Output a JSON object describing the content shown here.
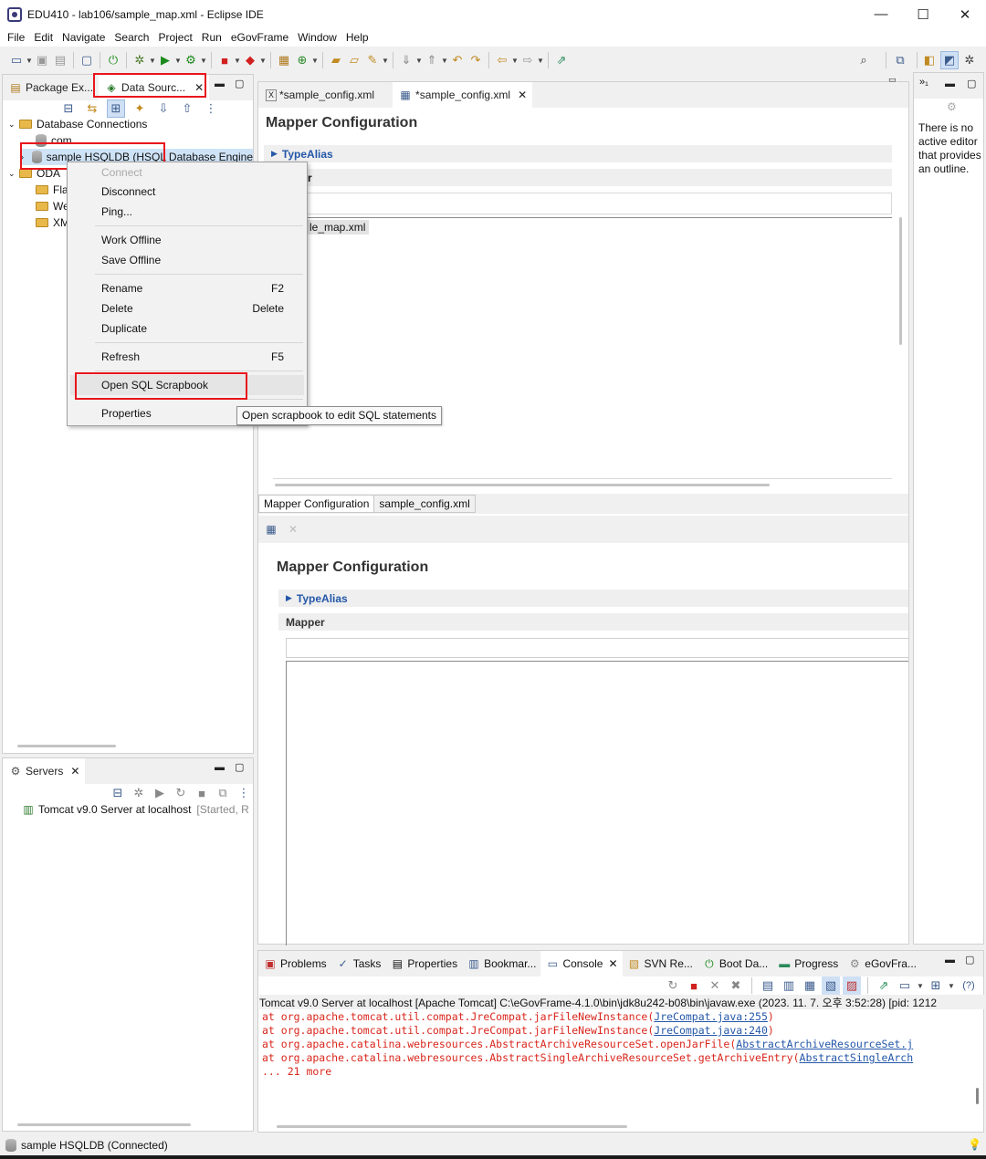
{
  "window": {
    "title": "EDU410 - lab106/sample_map.xml - Eclipse IDE",
    "minimize": "—",
    "maximize": "☐",
    "close": "✕"
  },
  "menubar": [
    "File",
    "Edit",
    "Navigate",
    "Search",
    "Project",
    "Run",
    "eGovFrame",
    "Window",
    "Help"
  ],
  "left_panel": {
    "tabs": [
      {
        "label": "Package Ex...",
        "icon": "package-explorer-icon"
      },
      {
        "label": "Data Sourc...",
        "icon": "data-source-icon",
        "close": "✕"
      }
    ],
    "tree": {
      "database_connections": "Database Connections",
      "com": "com",
      "sample": "sample HSQLDB (HSQL Database Engine",
      "oda": "ODA",
      "oda_children": [
        "Fla",
        "We",
        "XM"
      ]
    }
  },
  "context_menu": {
    "items": [
      {
        "label": "Connect",
        "accel": "",
        "disabled": true
      },
      {
        "label": "Disconnect",
        "accel": ""
      },
      {
        "label": "Ping...",
        "accel": ""
      },
      {
        "label": "Work Offline",
        "accel": ""
      },
      {
        "label": "Save Offline",
        "accel": ""
      },
      {
        "label": "Rename",
        "accel": "F2"
      },
      {
        "label": "Delete",
        "accel": "Delete"
      },
      {
        "label": "Duplicate",
        "accel": ""
      },
      {
        "label": "Refresh",
        "accel": "F5"
      },
      {
        "label": "Open SQL Scrapbook",
        "accel": ""
      },
      {
        "label": "Properties",
        "accel": ""
      }
    ],
    "tooltip": "Open scrapbook to edit SQL statements"
  },
  "editor": {
    "tabs": [
      {
        "label": "*sample_config.xml",
        "icon": "xml-file-icon"
      },
      {
        "label": "*sample_config.xml",
        "icon": "xml-editor-icon",
        "close": "✕"
      }
    ],
    "title": "Mapper Configuration",
    "type_alias": "TypeAlias",
    "mapper_partial": "r",
    "mapper_item": "le_map.xml",
    "bottom_tabs": [
      "Mapper Configuration",
      "sample_config.xml"
    ],
    "second_title": "Mapper Configuration",
    "second_type_alias": "TypeAlias",
    "second_mapper": "Mapper"
  },
  "outline": {
    "message": "There is no active editor that provides an outline."
  },
  "servers": {
    "tab": "Servers",
    "close": "✕",
    "server": "Tomcat v9.0 Server at localhost",
    "status": "[Started, R"
  },
  "bottom_panel": {
    "tabs": [
      "Problems",
      "Tasks",
      "Properties",
      "Bookmar...",
      "Console",
      "SVN Re...",
      "Boot Da...",
      "Progress",
      "eGovFra..."
    ],
    "console_header": "Tomcat v9.0 Server at localhost [Apache Tomcat] C:\\eGovFrame-4.1.0\\bin\\jdk8u242-b08\\bin\\javaw.exe  (2023. 11. 7. 오후 3:52:28) [pid: 1212",
    "lines": [
      {
        "text": "        at org.apache.tomcat.util.compat.JreCompat.jarFileNewInstance(",
        "link": "JreCompat.java:255",
        "tail": ")"
      },
      {
        "text": "        at org.apache.tomcat.util.compat.JreCompat.jarFileNewInstance(",
        "link": "JreCompat.java:240",
        "tail": ")"
      },
      {
        "text": "        at org.apache.catalina.webresources.AbstractArchiveResourceSet.openJarFile(",
        "link": "AbstractArchiveResourceSet.j",
        "tail": ""
      },
      {
        "text": "        at org.apache.catalina.webresources.AbstractSingleArchiveResourceSet.getArchiveEntry(",
        "link": "AbstractSingleArch",
        "tail": ""
      },
      {
        "text": "        ... 21 more",
        "link": "",
        "tail": ""
      }
    ]
  },
  "statusbar": {
    "text": "sample HSQLDB (Connected)"
  },
  "colors": {
    "highlight_red": "#e8161c",
    "console_error": "#d9261c",
    "link_blue": "#2457a8"
  }
}
